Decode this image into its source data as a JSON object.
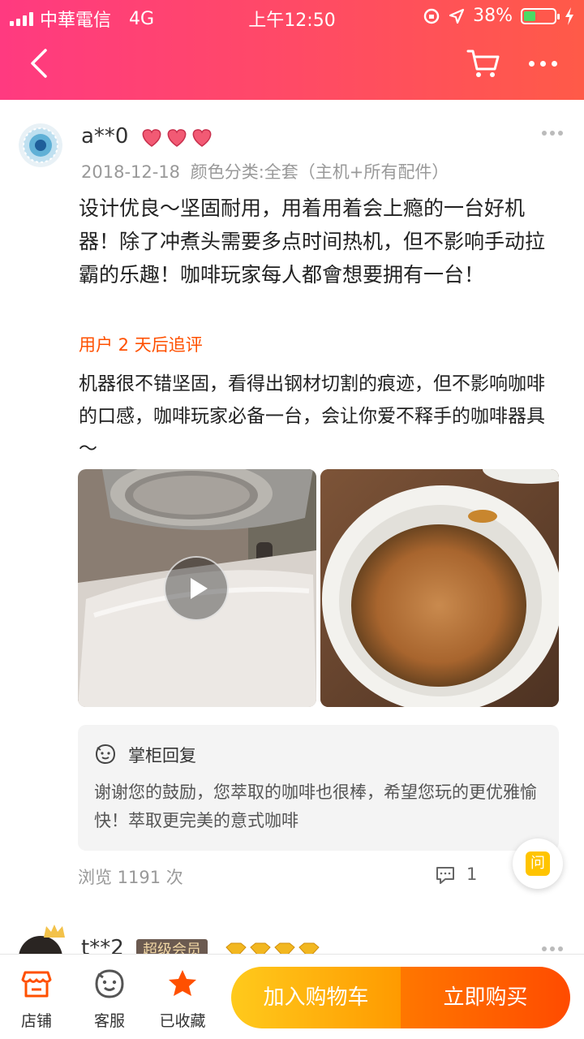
{
  "status_bar": {
    "carrier": "中華電信",
    "network": "4G",
    "time": "上午12:50",
    "battery": "38%",
    "battery_level": 0.38
  },
  "header": {
    "back_icon": "chevron-left-icon",
    "cart_icon": "cart-icon",
    "more_icon": "more-dots-icon"
  },
  "review": {
    "username": "a**0",
    "date": "2018-12-18",
    "spec": "颜色分类:全套（主机+所有配件）",
    "text": "设计优良～坚固耐用，用着用着会上瘾的一台好机器！除了冲煮头需要多点时间热机，但不影响手动拉霸的乐趣！咖啡玩家每人都會想要拥有一台！",
    "followup_label": "用户 2 天后追评",
    "followup_text": "机器很不错坚固，看得出钢材切割的痕迹，但不影响咖啡的口感，咖啡玩家必备一台，会让你爱不释手的咖啡器具～",
    "reply_title": "掌柜回复",
    "reply_text": "谢谢您的鼓励，您萃取的咖啡也很棒，希望您玩的更优雅愉快！萃取更完美的意式咖啡",
    "views": "浏览 1191 次",
    "comments": "1",
    "ask_label": "问"
  },
  "next_review": {
    "username": "t**2",
    "badge": "超级会员"
  },
  "bottom_bar": {
    "store_label": "店铺",
    "service_label": "客服",
    "favorite_label": "已收藏",
    "add_cart_label": "加入购物车",
    "buy_now_label": "立即购买",
    "accent": "#ff5000"
  }
}
